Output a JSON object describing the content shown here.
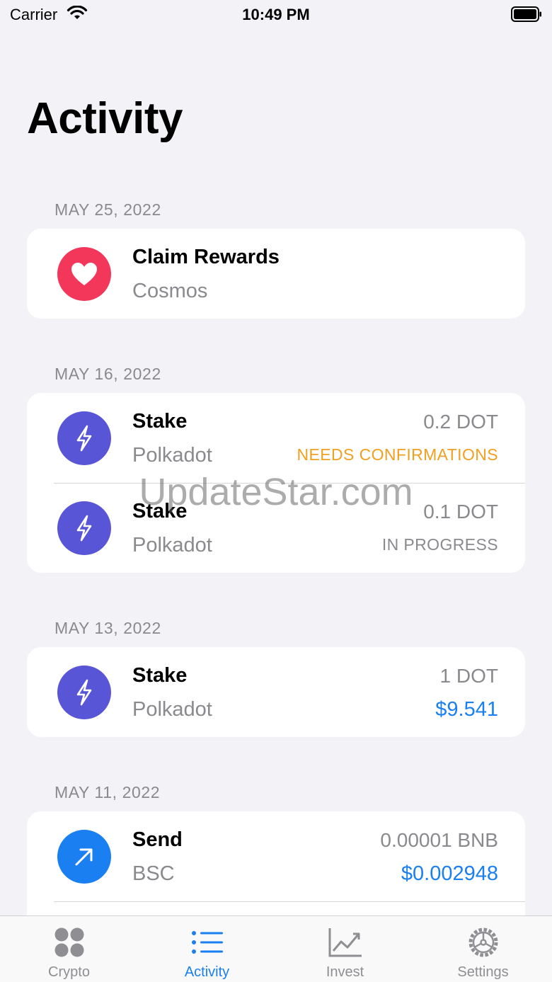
{
  "status_bar": {
    "carrier": "Carrier",
    "time": "10:49 PM"
  },
  "page": {
    "title": "Activity"
  },
  "sections": [
    {
      "date": "MAY 25, 2022",
      "items": [
        {
          "title": "Claim Rewards",
          "subtitle": "Cosmos",
          "icon": "heart-icon",
          "icon_color": "#f2375a"
        }
      ]
    },
    {
      "date": "MAY 16, 2022",
      "items": [
        {
          "title": "Stake",
          "subtitle": "Polkadot",
          "amount": "0.2 DOT",
          "status": "NEEDS CONFIRMATIONS",
          "icon": "bolt-icon",
          "icon_color": "#5856d6"
        },
        {
          "title": "Stake",
          "subtitle": "Polkadot",
          "amount": "0.1 DOT",
          "status": "IN PROGRESS",
          "icon": "bolt-icon",
          "icon_color": "#5856d6"
        }
      ]
    },
    {
      "date": "MAY 13, 2022",
      "items": [
        {
          "title": "Stake",
          "subtitle": "Polkadot",
          "amount": "1 DOT",
          "fiat": "$9.541",
          "icon": "bolt-icon",
          "icon_color": "#5856d6"
        }
      ]
    },
    {
      "date": "MAY 11, 2022",
      "items": [
        {
          "title": "Send",
          "subtitle": "BSC",
          "amount": "0.00001 BNB",
          "fiat": "$0.002948",
          "icon": "arrow-up-right-icon",
          "icon_color": "#1a7ff0"
        }
      ]
    }
  ],
  "watermark": "UpdateStar.com",
  "tab_bar": {
    "tabs": [
      {
        "label": "Crypto",
        "icon": "grid-dots-icon",
        "active": false
      },
      {
        "label": "Activity",
        "icon": "list-icon",
        "active": true
      },
      {
        "label": "Invest",
        "icon": "chart-line-icon",
        "active": false
      },
      {
        "label": "Settings",
        "icon": "gear-icon",
        "active": false
      }
    ]
  },
  "colors": {
    "accent": "#1a7ff0",
    "warning": "#f0a020",
    "secondary_text": "#8a8a8e",
    "background": "#f2f2f7"
  }
}
